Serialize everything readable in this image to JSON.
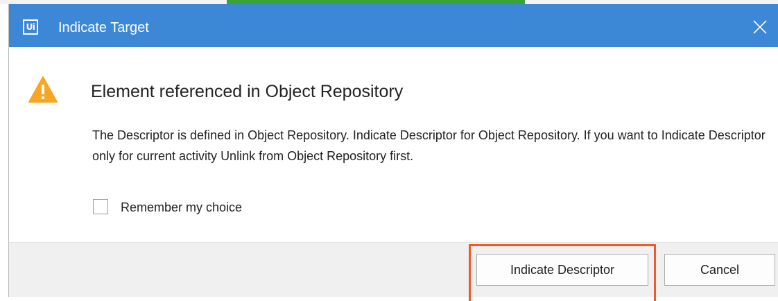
{
  "dialog": {
    "logo_text": "Ui",
    "title": "Indicate Target",
    "close_icon": "close-icon",
    "warning_icon": "warning-icon",
    "heading": "Element referenced in Object Repository",
    "message": "The Descriptor is defined in Object Repository. Indicate Descriptor for Object Repository. If you want to Indicate Descriptor only for current activity Unlink from Object Repository first.",
    "remember_label": "Remember my choice",
    "remember_checked": false,
    "primary_button": "Indicate Descriptor",
    "cancel_button": "Cancel"
  },
  "colors": {
    "titlebar": "#3c87d6",
    "warning": "#f6a623",
    "highlight": "#f05a28",
    "footer": "#f0f0f0"
  }
}
